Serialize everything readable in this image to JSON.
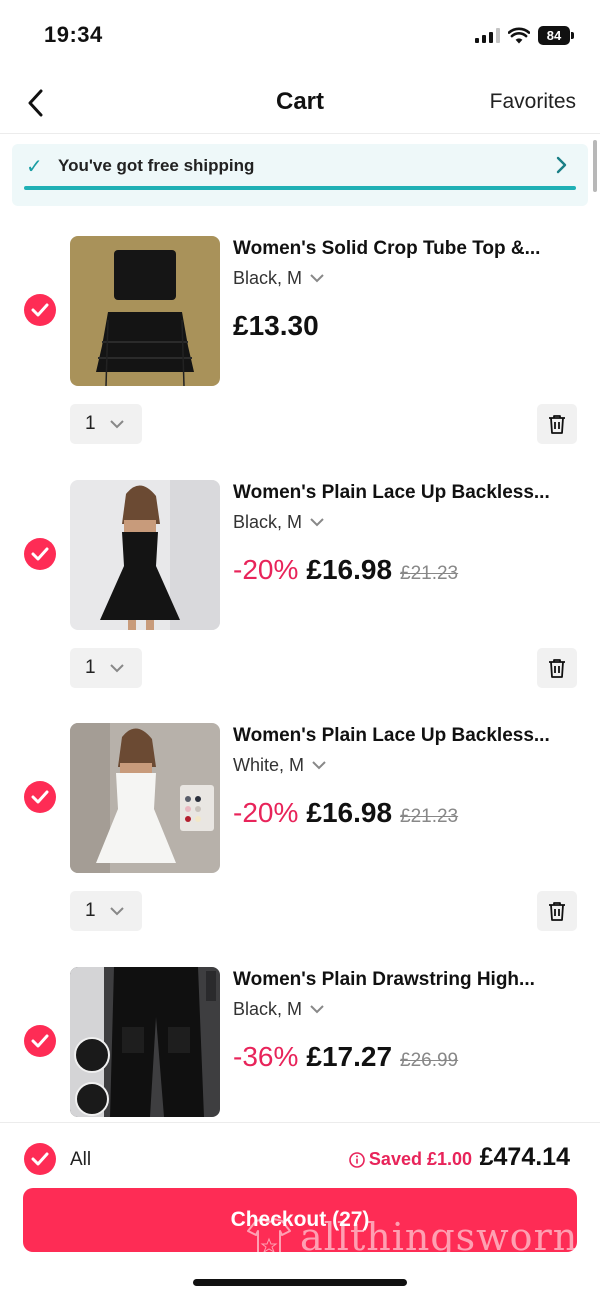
{
  "status_bar": {
    "time": "19:34",
    "battery": "84",
    "icons": [
      "signal-icon",
      "wifi-icon",
      "battery-icon"
    ]
  },
  "nav": {
    "back_icon": "chevron-left-icon",
    "title": "Cart",
    "favorites": "Favorites"
  },
  "shipping": {
    "icon": "checkmark-icon",
    "text": "You've got free shipping",
    "arrow_icon": "chevron-right-icon",
    "progress": 1.0
  },
  "items": [
    {
      "title": "Women's Solid Crop Tube Top &...",
      "variant": "Black, M",
      "discount": "",
      "price": "£13.30",
      "original_price": "",
      "quantity": "1",
      "selected": true,
      "image": "black-crop-top-and-skirt-set"
    },
    {
      "title": "Women's Plain Lace Up Backless...",
      "variant": "Black, M",
      "discount": "-20%",
      "price": "£16.98",
      "original_price": "£21.23",
      "quantity": "1",
      "selected": true,
      "image": "black-lace-up-dress"
    },
    {
      "title": "Women's Plain Lace Up Backless...",
      "variant": "White, M",
      "discount": "-20%",
      "price": "£16.98",
      "original_price": "£21.23",
      "quantity": "1",
      "selected": true,
      "image": "white-lace-up-dress"
    },
    {
      "title": "Women's Plain Drawstring High...",
      "variant": "Black, M",
      "discount": "-36%",
      "price": "£17.27",
      "original_price": "£26.99",
      "quantity": "1",
      "selected": true,
      "image": "black-cargo-pants"
    }
  ],
  "footer": {
    "all_label": "All",
    "saved_label": "Saved £1.00",
    "total": "£474.14",
    "checkout_label": "Checkout (27)",
    "watermark": "allthingsworn"
  },
  "colors": {
    "accent": "#fe2c55",
    "discount": "#e8245a",
    "teal": "#1fb0b5",
    "banner_bg": "#eef8f9"
  }
}
